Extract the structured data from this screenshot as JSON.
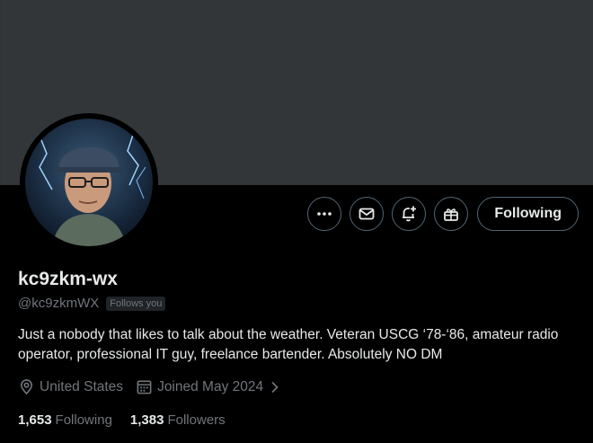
{
  "profile": {
    "display_name": "kc9zkm-wx",
    "handle": "@kc9zkmWX",
    "follows_you_badge": "Follows you",
    "bio": "Just a nobody that likes to talk about the weather. Veteran USCG ‘78-‘86, amateur radio operator, professional IT guy, freelance bartender. Absolutely NO DM",
    "location": "United States",
    "joined": "Joined May 2024"
  },
  "stats": {
    "following_count": "1,653",
    "following_label": "Following",
    "followers_count": "1,383",
    "followers_label": "Followers"
  },
  "actions": {
    "more_icon": "more-dots-icon",
    "message_icon": "mail-icon",
    "notify_icon": "bell-plus-icon",
    "subscribe_icon": "gift-icon",
    "follow_button_label": "Following"
  },
  "colors": {
    "background": "#000000",
    "banner": "#333639",
    "primary_text": "#e7e9ea",
    "secondary_text": "#71767b",
    "border": "#536471"
  }
}
